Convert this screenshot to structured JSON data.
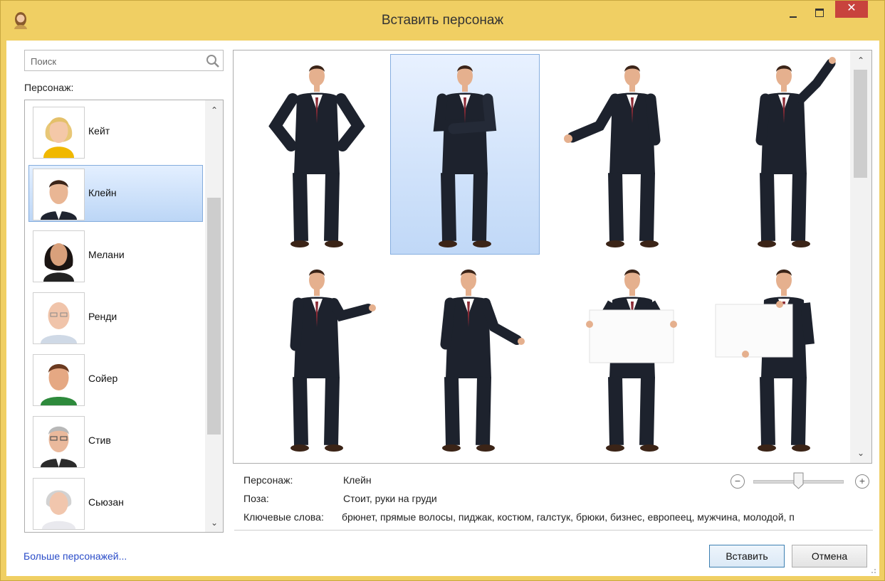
{
  "window": {
    "title": "Вставить персонаж",
    "close_glyph": "✕",
    "icon": "avatar-icon",
    "accent_color": "#f0cf63",
    "close_color": "#c8433d",
    "selection_color": "#bcd6f6"
  },
  "left": {
    "search_placeholder": "Поиск",
    "character_label": "Персонаж:",
    "characters": [
      {
        "name": "Кейт"
      },
      {
        "name": "Клейн"
      },
      {
        "name": "Мелани"
      },
      {
        "name": "Ренди"
      },
      {
        "name": "Сойер"
      },
      {
        "name": "Стив"
      },
      {
        "name": "Сьюзан"
      }
    ],
    "selected_character": "Клейн",
    "more_link": "Больше персонажей..."
  },
  "info": {
    "character_label": "Персонаж:",
    "character_value": "Клейн",
    "pose_label": "Поза:",
    "pose_value": "Стоит, руки на груди",
    "keywords_label": "Ключевые слова:",
    "keywords_value": "брюнет, прямые волосы, пиджак,  костюм, галстук, брюки, бизнес, европеец, мужчина, молодой, п"
  },
  "zoom": {
    "level": 0.5
  },
  "buttons": {
    "insert": "Вставить",
    "cancel": "Отмена"
  },
  "scroll_arrows": {
    "up": "⌃",
    "down": "⌄"
  }
}
